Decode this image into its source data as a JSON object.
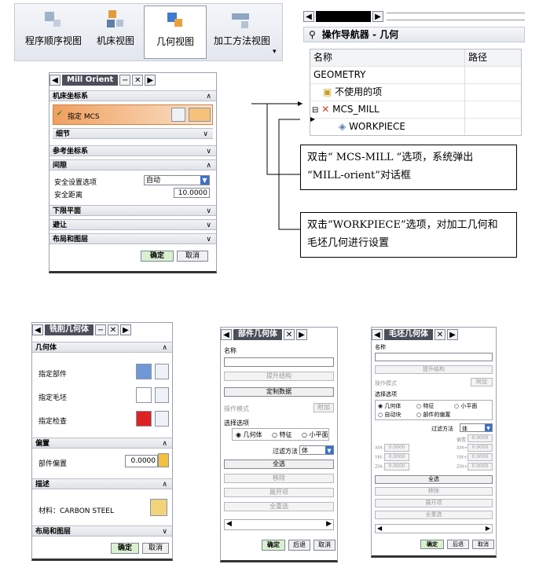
{
  "toolbar": {
    "items": [
      {
        "label": "程序顺序视图",
        "icon": "program-order-view-icon"
      },
      {
        "label": "机床视图",
        "icon": "machine-view-icon"
      },
      {
        "label": "几何视图",
        "icon": "geometry-view-icon",
        "active": true
      },
      {
        "label": "加工方法视图",
        "icon": "machining-method-view-icon"
      }
    ],
    "more": "▾"
  },
  "navigator": {
    "title": "操作导航器 - 几何",
    "columns": [
      "名称",
      "路径"
    ],
    "rows": [
      "GEOMETRY",
      "不使用的项",
      "MCS_MILL",
      "WORKPIECE"
    ]
  },
  "callouts": {
    "mcs_line1": "双击“ MCS-MILL ”选项，系统弹出",
    "mcs_line2": "“MILL-orient”对话框",
    "wp_line1": "双击“WORKPIECE”选项，对加工几何和",
    "wp_line2": "毛坯几何进行设置"
  },
  "mill_orient": {
    "title": "Mill Orient",
    "sec_machine": "机床坐标系",
    "specify_mcs": "指定 MCS",
    "details": "细节",
    "sec_ref": "参考坐标系",
    "sec_clearance": "间隙",
    "safety_option_label": "安全设置选项",
    "safety_option_value": "自动",
    "safety_distance_label": "安全距离",
    "safety_distance_value": "10.0000",
    "sec_lower": "下限平面",
    "sec_avoid": "避让",
    "sec_layout": "布局和图层",
    "ok": "确定",
    "cancel": "取消"
  },
  "mill_geom": {
    "title": "铣削几何体",
    "sec_geometry": "几何体",
    "specify_part": "指定部件",
    "specify_blank": "指定毛坯",
    "specify_check": "指定检查",
    "sec_offset": "偏置",
    "part_offset_label": "部件偏置",
    "part_offset_value": "0.0000",
    "sec_desc": "描述",
    "material": "材料：CARBON STEEL",
    "sec_layout": "布局和图层",
    "ok": "确定",
    "cancel": "取消"
  },
  "part_geom": {
    "title": "部件几何体",
    "name_label": "名称",
    "promote": "提升结构",
    "custom_data": "定制数据",
    "op_mode_label": "操作模式",
    "op_mode_value": "附加",
    "select_options": "选择选项",
    "radio_geometry": "几何体",
    "radio_feature": "特征",
    "radio_facet": "小平面",
    "filter_label": "过滤方法",
    "filter_value": "体",
    "btn_all": "全选",
    "btn_remove": "移除",
    "btn_expand": "展开项",
    "btn_deselect": "全重选",
    "ok": "确定",
    "back": "后退",
    "cancel": "取消"
  },
  "blank_geom": {
    "title": "毛坯几何体",
    "name_label": "名称",
    "promote": "提升结构",
    "op_mode_label": "操作模式",
    "op_mode_value": "附加",
    "select_options": "选择选项",
    "radio_geometry": "几何体",
    "radio_feature": "特征",
    "radio_facet": "小平面",
    "radio_autoblock": "自动块",
    "radio_offset_part": "部件的偏置",
    "filter_label": "过滤方法",
    "filter_value": "体",
    "offset_label": "偏置",
    "offset_value": "0.0000",
    "zm_xm": [
      [
        "XM-",
        "0.0000",
        "XM+",
        "0.0000"
      ],
      [
        "YM-",
        "0.0000",
        "YM+",
        "0.0000"
      ],
      [
        "ZM-",
        "0.0000",
        "ZM+",
        "0.0000"
      ]
    ],
    "btn_all": "全选",
    "btn_remove": "移除",
    "btn_expand": "展开项",
    "btn_deselect": "全重选",
    "ok": "确定",
    "back": "后退",
    "cancel": "取消"
  },
  "colors": {
    "accent_orange": "#f0a060",
    "ok_green": "#d9f0d0",
    "dark_title": "#4a4f5a"
  }
}
